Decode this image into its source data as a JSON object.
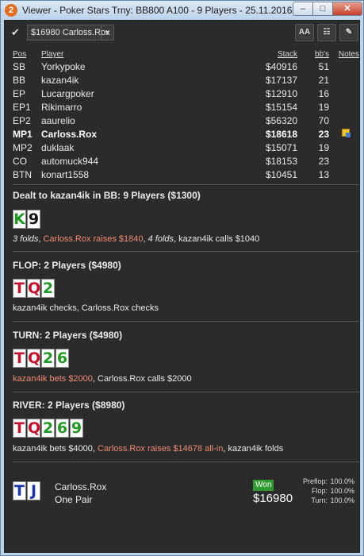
{
  "window": {
    "app_icon": "2",
    "title": "Viewer - Poker Stars Trny: BB800 A100 - 9 Players - 25.11.2016 6:33",
    "min_label": "‒",
    "max_label": "□",
    "close_label": "✕"
  },
  "toolbar": {
    "selected_player": "$16980 Carloss.Rox",
    "font_button": "AA",
    "grid_button": "☷",
    "edit_button": "✎"
  },
  "table": {
    "headers": {
      "pos": "Pos",
      "player": "Player",
      "stack": "Stack",
      "bbs": "bb's",
      "notes": "Notes"
    },
    "rows": [
      {
        "pos": "SB",
        "player": "Yorkypoke",
        "stack": "$40916",
        "bbs": "51"
      },
      {
        "pos": "BB",
        "player": "kazan4ik",
        "stack": "$17137",
        "bbs": "21"
      },
      {
        "pos": "EP",
        "player": "Lucargpoker",
        "stack": "$12910",
        "bbs": "16"
      },
      {
        "pos": "EP1",
        "player": "Rikimarro",
        "stack": "$15154",
        "bbs": "19"
      },
      {
        "pos": "EP2",
        "player": "aaurelio",
        "stack": "$56320",
        "bbs": "70"
      },
      {
        "pos": "MP1",
        "player": "Carloss.Rox",
        "stack": "$18618",
        "bbs": "23"
      },
      {
        "pos": "MP2",
        "player": "duklaak",
        "stack": "$15071",
        "bbs": "19"
      },
      {
        "pos": "CO",
        "player": "automuck944",
        "stack": "$18153",
        "bbs": "23"
      },
      {
        "pos": "BTN",
        "player": "konart1558",
        "stack": "$10451",
        "bbs": "13"
      }
    ]
  },
  "preflop": {
    "title": "Dealt to kazan4ik in BB: 9 Players ($1300)",
    "cards": [
      {
        "rank": "K",
        "suit": "clubs",
        "color": "#1e9a22"
      },
      {
        "rank": "9",
        "suit": "spades",
        "color": "#111111"
      }
    ],
    "action_a": "3 folds",
    "action_sep1": ", ",
    "action_b": "Carloss.Rox raises $1840",
    "action_sep2": ", ",
    "action_c": "4 folds",
    "action_d": ", kazan4ik calls $1040"
  },
  "flop": {
    "title": "FLOP: 2 Players ($4980)",
    "cards": [
      {
        "rank": "T",
        "suit": "hearts",
        "color": "#c8102e"
      },
      {
        "rank": "Q",
        "suit": "hearts",
        "color": "#c8102e"
      },
      {
        "rank": "2",
        "suit": "clubs",
        "color": "#1e9a22"
      }
    ],
    "action": "kazan4ik checks, Carloss.Rox checks"
  },
  "turn": {
    "title": "TURN: 2 Players ($4980)",
    "cards": [
      {
        "rank": "T",
        "suit": "hearts",
        "color": "#c8102e"
      },
      {
        "rank": "Q",
        "suit": "hearts",
        "color": "#c8102e"
      },
      {
        "rank": "2",
        "suit": "clubs",
        "color": "#1e9a22"
      },
      {
        "rank": "6",
        "suit": "clubs",
        "color": "#1e9a22"
      }
    ],
    "action_a": "kazan4ik bets $2000",
    "action_b": ", Carloss.Rox calls $2000"
  },
  "river": {
    "title": "RIVER: 2 Players ($8980)",
    "cards": [
      {
        "rank": "T",
        "suit": "hearts",
        "color": "#c8102e"
      },
      {
        "rank": "Q",
        "suit": "hearts",
        "color": "#c8102e"
      },
      {
        "rank": "2",
        "suit": "clubs",
        "color": "#1e9a22"
      },
      {
        "rank": "6",
        "suit": "clubs",
        "color": "#1e9a22"
      },
      {
        "rank": "9",
        "suit": "clubs",
        "color": "#1e9a22"
      }
    ],
    "action_a": "kazan4ik bets $4000, ",
    "action_b": "Carloss.Rox raises $14678 all-in",
    "action_c": ", kazan4ik folds"
  },
  "result": {
    "cards": [
      {
        "rank": "T",
        "suit": "spades",
        "color": "#1a33a8"
      },
      {
        "rank": "J",
        "suit": "spades",
        "color": "#1a33a8"
      }
    ],
    "player": "Carloss.Rox",
    "hand": "One Pair",
    "won_label": "Won",
    "amount": "$16980",
    "odds": [
      {
        "label": "Preflop:",
        "value": "100.0%"
      },
      {
        "label": "Flop:",
        "value": "100.0%"
      },
      {
        "label": "Turn:",
        "value": "100.0%"
      }
    ]
  },
  "colors": {
    "highlight": "#ef8a72",
    "background": "#2b2b2b",
    "won": "#2f9c2f"
  }
}
